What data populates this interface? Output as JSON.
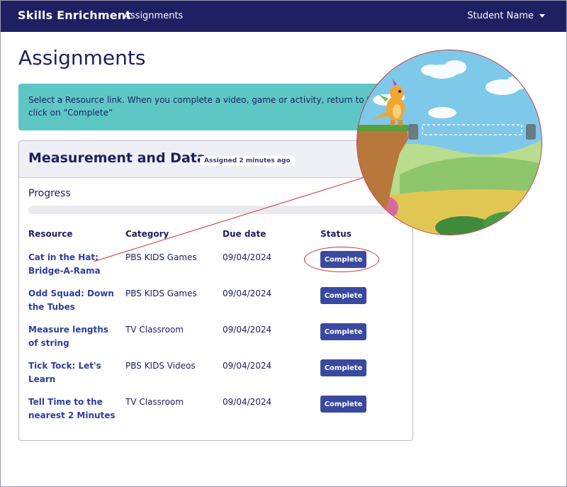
{
  "navbar": {
    "brand": "Skills Enrichment",
    "nav_link": "Assignments",
    "user": "Student Name"
  },
  "page": {
    "title": "Assignments"
  },
  "alert": {
    "line1": "Select a Resource link. When you complete a video, game or activity, return to this p",
    "line2": "click on “Complete”"
  },
  "card": {
    "title": "Measurement and Data",
    "assigned": "Assigned 2 minutes ago",
    "progress_label": "Progress",
    "progress_percent": 0,
    "columns": {
      "resource": "Resource",
      "category": "Category",
      "due": "Due date",
      "status": "Status"
    },
    "rows": [
      {
        "resource": "Cat in the Hat: Bridge-A-Rama",
        "category": "PBS KIDS Games",
        "due": "09/04/2024",
        "status": "Complete"
      },
      {
        "resource": "Odd Squad: Down the Tubes",
        "category": "PBS KIDS Games",
        "due": "09/04/2024",
        "status": "Complete"
      },
      {
        "resource": "Measure lengths of string",
        "category": "TV Classroom",
        "due": "09/04/2024",
        "status": "Complete"
      },
      {
        "resource": "Tick Tock: Let's Learn",
        "category": "PBS KIDS Videos",
        "due": "09/04/2024",
        "status": "Complete"
      },
      {
        "resource": "Tell Time to the nearest 2 Minutes",
        "category": "TV Classroom",
        "due": "09/04/2024",
        "status": "Complete"
      }
    ]
  },
  "colors": {
    "navbar": "#1f2063",
    "alert": "#5ec7c5",
    "button": "#3a49a0",
    "annotation": "#c8333a"
  }
}
